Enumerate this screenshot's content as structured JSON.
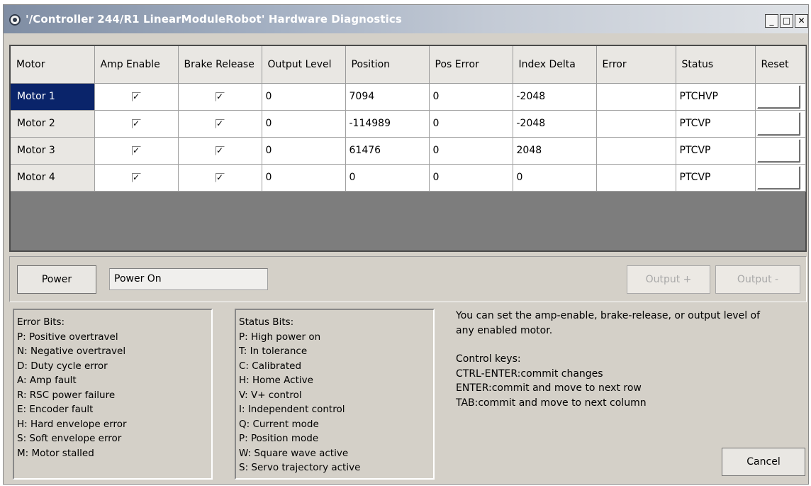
{
  "window": {
    "title": "'/Controller 244/R1 LinearModuleRobot' Hardware Diagnostics",
    "min_label": "_",
    "max_label": "□",
    "close_label": "✕"
  },
  "grid": {
    "headers": [
      "Motor",
      "Amp Enable",
      "Brake Release",
      "Output Level",
      "Position",
      "Pos Error",
      "Index Delta",
      "Error",
      "Status",
      "Reset"
    ],
    "rows": [
      {
        "motor": "Motor 1",
        "amp_enable": "✓",
        "brake_release": "✓",
        "output_level": "0",
        "position": "7094",
        "pos_error": "0",
        "index_delta": "-2048",
        "error": "",
        "status": "PTCHVP",
        "reset": ""
      },
      {
        "motor": "Motor 2",
        "amp_enable": "✓",
        "brake_release": "✓",
        "output_level": "0",
        "position": "-114989",
        "pos_error": "0",
        "index_delta": "-2048",
        "error": "",
        "status": "PTCVP",
        "reset": ""
      },
      {
        "motor": "Motor 3",
        "amp_enable": "✓",
        "brake_release": "✓",
        "output_level": "0",
        "position": "61476",
        "pos_error": "0",
        "index_delta": "2048",
        "error": "",
        "status": "PTCVP",
        "reset": ""
      },
      {
        "motor": "Motor 4",
        "amp_enable": "✓",
        "brake_release": "✓",
        "output_level": "0",
        "position": "0",
        "pos_error": "0",
        "index_delta": "0",
        "error": "",
        "status": "PTCVP",
        "reset": ""
      }
    ]
  },
  "power": {
    "button_label": "Power",
    "status_value": "Power On",
    "output_plus_label": "Output +",
    "output_minus_label": "Output -"
  },
  "error_bits": {
    "title": "Error Bits:",
    "items": [
      "P: Positive overtravel",
      "N: Negative overtravel",
      "D: Duty cycle error",
      "A: Amp fault",
      "R: RSC power failure",
      "E: Encoder fault",
      "H: Hard envelope error",
      "S: Soft envelope error",
      "M: Motor stalled"
    ]
  },
  "status_bits": {
    "title": "Status Bits:",
    "items": [
      "P: High power on",
      "T: In tolerance",
      "C: Calibrated",
      "H: Home Active",
      "V: V+ control",
      "I: Independent control",
      "Q: Current mode",
      "P: Position mode",
      "W: Square wave active",
      "S: Servo trajectory active"
    ]
  },
  "help": {
    "line1": "You can set the amp-enable, brake-release, or output level of",
    "line2": "any enabled motor.",
    "keys_title": "Control keys:",
    "keys": [
      "CTRL-ENTER:commit changes",
      "ENTER:commit and move to next row",
      "TAB:commit and move to next column"
    ]
  },
  "cancel_label": "Cancel"
}
